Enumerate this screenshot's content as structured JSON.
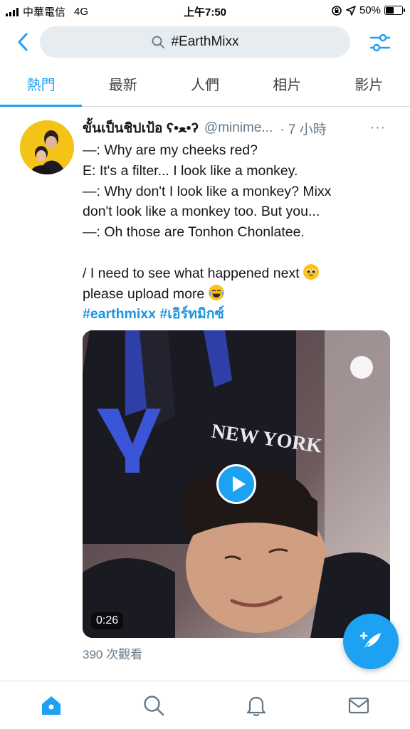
{
  "status_bar": {
    "carrier": "中華電信",
    "network": "4G",
    "time": "上午7:50",
    "battery": "50%",
    "battery_level": 0.5
  },
  "search": {
    "query": "#EarthMixx"
  },
  "tabs": [
    {
      "label": "熱門",
      "active": true
    },
    {
      "label": "最新",
      "active": false
    },
    {
      "label": "人們",
      "active": false
    },
    {
      "label": "相片",
      "active": false
    },
    {
      "label": "影片",
      "active": false
    }
  ],
  "tweet": {
    "display_name": "ขั้นเป็นชิปเป้อ ʕ•ﻌ•ʔ",
    "handle": "@minime...",
    "time": "· 7 小時",
    "more": "···",
    "lines": [
      "—: Why are my cheeks red?",
      "E: It's a filter... I look like a monkey.",
      "—: Why don't I look like a monkey? Mixx",
      "don't look like a monkey too. But you...",
      "—: Oh those are Tonhon Chonlatee.",
      "",
      "/ I need to see what happened next",
      "please upload more"
    ],
    "hashtag_1": "#earthmixx",
    "hashtag_2": "#เอิร์ทมิกซ์",
    "video_duration": "0:26",
    "views": "390 次觀看"
  },
  "colors": {
    "accent": "#1da1f2",
    "hashtag": "#1b95e0",
    "muted": "#657786"
  },
  "nav": [
    {
      "icon": "home-icon",
      "active": true
    },
    {
      "icon": "search-icon",
      "active": false
    },
    {
      "icon": "bell-icon",
      "active": false
    },
    {
      "icon": "mail-icon",
      "active": false
    }
  ]
}
